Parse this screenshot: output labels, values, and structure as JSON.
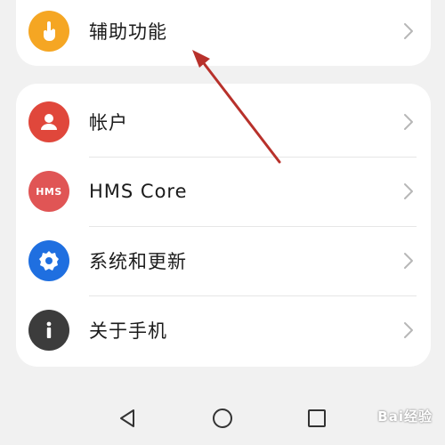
{
  "settings": {
    "top_item": {
      "label": "辅助功能",
      "icon": "hand-touch-icon",
      "icon_color": "#f5a623"
    },
    "items": [
      {
        "label": "帐户",
        "icon": "person-icon",
        "icon_color": "#e0473b"
      },
      {
        "label": "HMS Core",
        "icon": "hms-core-icon",
        "icon_text": "HMS",
        "icon_color": "#e05555"
      },
      {
        "label": "系统和更新",
        "icon": "gear-icon",
        "icon_color": "#1f6fe0"
      },
      {
        "label": "关于手机",
        "icon": "info-icon",
        "icon_color": "#3c3c3c"
      }
    ]
  },
  "navbar": {
    "buttons": [
      "back-button",
      "home-button",
      "recents-button"
    ]
  },
  "annotation": {
    "color": "#b8312b"
  },
  "watermark": {
    "text": "Bai经验"
  }
}
